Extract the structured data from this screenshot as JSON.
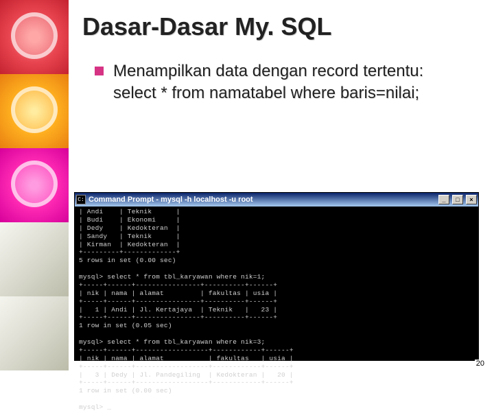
{
  "slide": {
    "title": "Dasar-Dasar My. SQL",
    "bullet_heading": "Menampilkan data dengan record tertentu:",
    "bullet_code": "select * from namatabel where baris=nilai;"
  },
  "terminal": {
    "title": "Command Prompt - mysql -h localhost -u root",
    "minimize": "_",
    "maximize": "□",
    "close": "×",
    "lines": [
      "| Andi    | Teknik      |",
      "| Budi    | Ekonomi     |",
      "| Dedy    | Kedokteran  |",
      "| Sandy   | Teknik      |",
      "| Kirman  | Kedokteran  |",
      "+---------+-------------+",
      "5 rows in set (0.00 sec)",
      "",
      "mysql> select * from tbl_karyawan where nik=1;",
      "+-----+------+----------------+----------+------+",
      "| nik | nama | alamat         | fakultas | usia |",
      "+-----+------+----------------+----------+------+",
      "|   1 | Andi | Jl. Kertajaya  | Teknik   |   23 |",
      "+-----+------+----------------+----------+------+",
      "1 row in set (0.05 sec)",
      "",
      "mysql> select * from tbl_karyawan where nik=3;",
      "+-----+------+------------------+------------+------+",
      "| nik | nama | alamat           | fakultas   | usia |",
      "+-----+------+------------------+------------+------+",
      "|   3 | Dedy | Jl. Pandegiling  | Kedokteran |   20 |",
      "+-----+------+------------------+------------+------+",
      "1 row in set (0.00 sec)",
      "",
      "mysql> _"
    ]
  },
  "page_number": "20"
}
